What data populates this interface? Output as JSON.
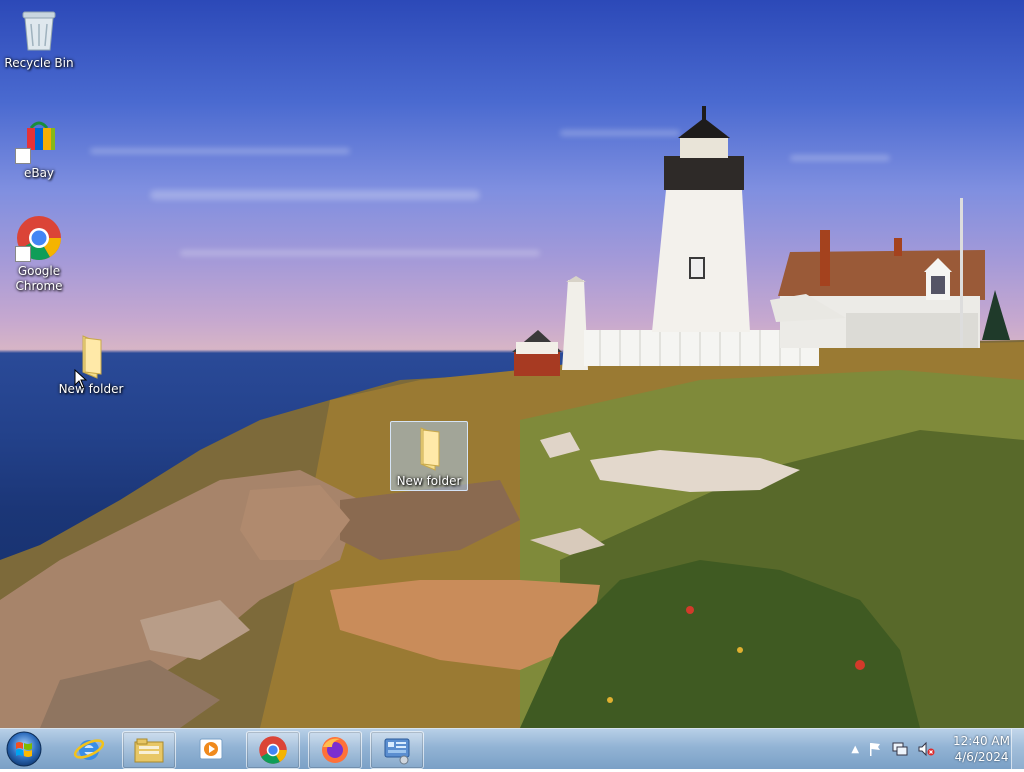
{
  "desktop": {
    "icons": [
      {
        "label": "Recycle Bin",
        "icon": "recycle-bin-icon"
      },
      {
        "label": "eBay",
        "icon": "ebay-icon"
      },
      {
        "label": "Google\nChrome",
        "icon": "chrome-icon"
      },
      {
        "label": "New folder",
        "icon": "folder-icon"
      },
      {
        "label": "New folder",
        "icon": "folder-icon",
        "selected": true
      }
    ]
  },
  "taskbar": {
    "start": {
      "icon": "windows-logo-icon"
    },
    "items": [
      {
        "name": "internet-explorer",
        "icon": "internet-explorer-icon"
      },
      {
        "name": "file-explorer",
        "icon": "folder-library-icon"
      },
      {
        "name": "media-player",
        "icon": "media-player-icon"
      },
      {
        "name": "google-chrome",
        "icon": "chrome-icon"
      },
      {
        "name": "firefox",
        "icon": "firefox-icon"
      },
      {
        "name": "control-panel",
        "icon": "control-panel-icon"
      }
    ],
    "tray": {
      "icons": [
        "show-hidden-icons-icon",
        "action-center-flag-icon",
        "network-icon",
        "volume-muted-icon"
      ],
      "time": "12:40 AM",
      "date": "4/6/2024"
    }
  }
}
